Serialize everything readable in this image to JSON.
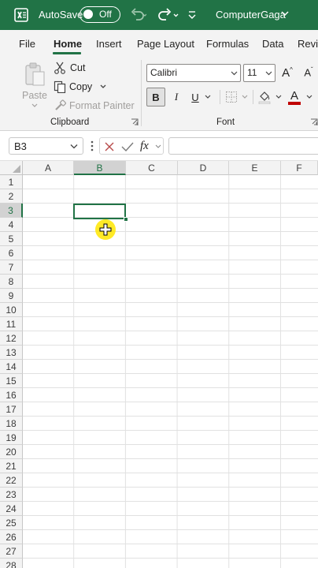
{
  "titlebar": {
    "autosave_label": "AutoSave",
    "autosave_state": "Off",
    "document_title": "ComputerGaga",
    "bg_color": "#217346"
  },
  "tabs": [
    "File",
    "Home",
    "Insert",
    "Page Layout",
    "Formulas",
    "Data",
    "Revi"
  ],
  "active_tab": "Home",
  "clipboard": {
    "paste_label": "Paste",
    "cut_label": "Cut",
    "copy_label": "Copy",
    "format_painter_label": "Format Painter",
    "group_label": "Clipboard"
  },
  "font": {
    "font_name": "Calibri",
    "font_size": "11",
    "group_label": "Font",
    "bold_label": "B",
    "italic_label": "I",
    "underline_label": "U",
    "font_color": "#c00000"
  },
  "formula_bar": {
    "name_box": "B3",
    "fx_label": "fx",
    "formula_value": ""
  },
  "columns": [
    "A",
    "B",
    "C",
    "D",
    "E",
    "F"
  ],
  "rows": [
    "1",
    "2",
    "3",
    "4",
    "5",
    "6",
    "7",
    "8",
    "9",
    "10",
    "11",
    "12",
    "13",
    "14",
    "15",
    "16",
    "17",
    "18",
    "19",
    "20",
    "21",
    "22",
    "23",
    "24",
    "25",
    "26",
    "27",
    "28"
  ],
  "selected_cell": "B3",
  "selected_column": "B",
  "selected_row": "3"
}
